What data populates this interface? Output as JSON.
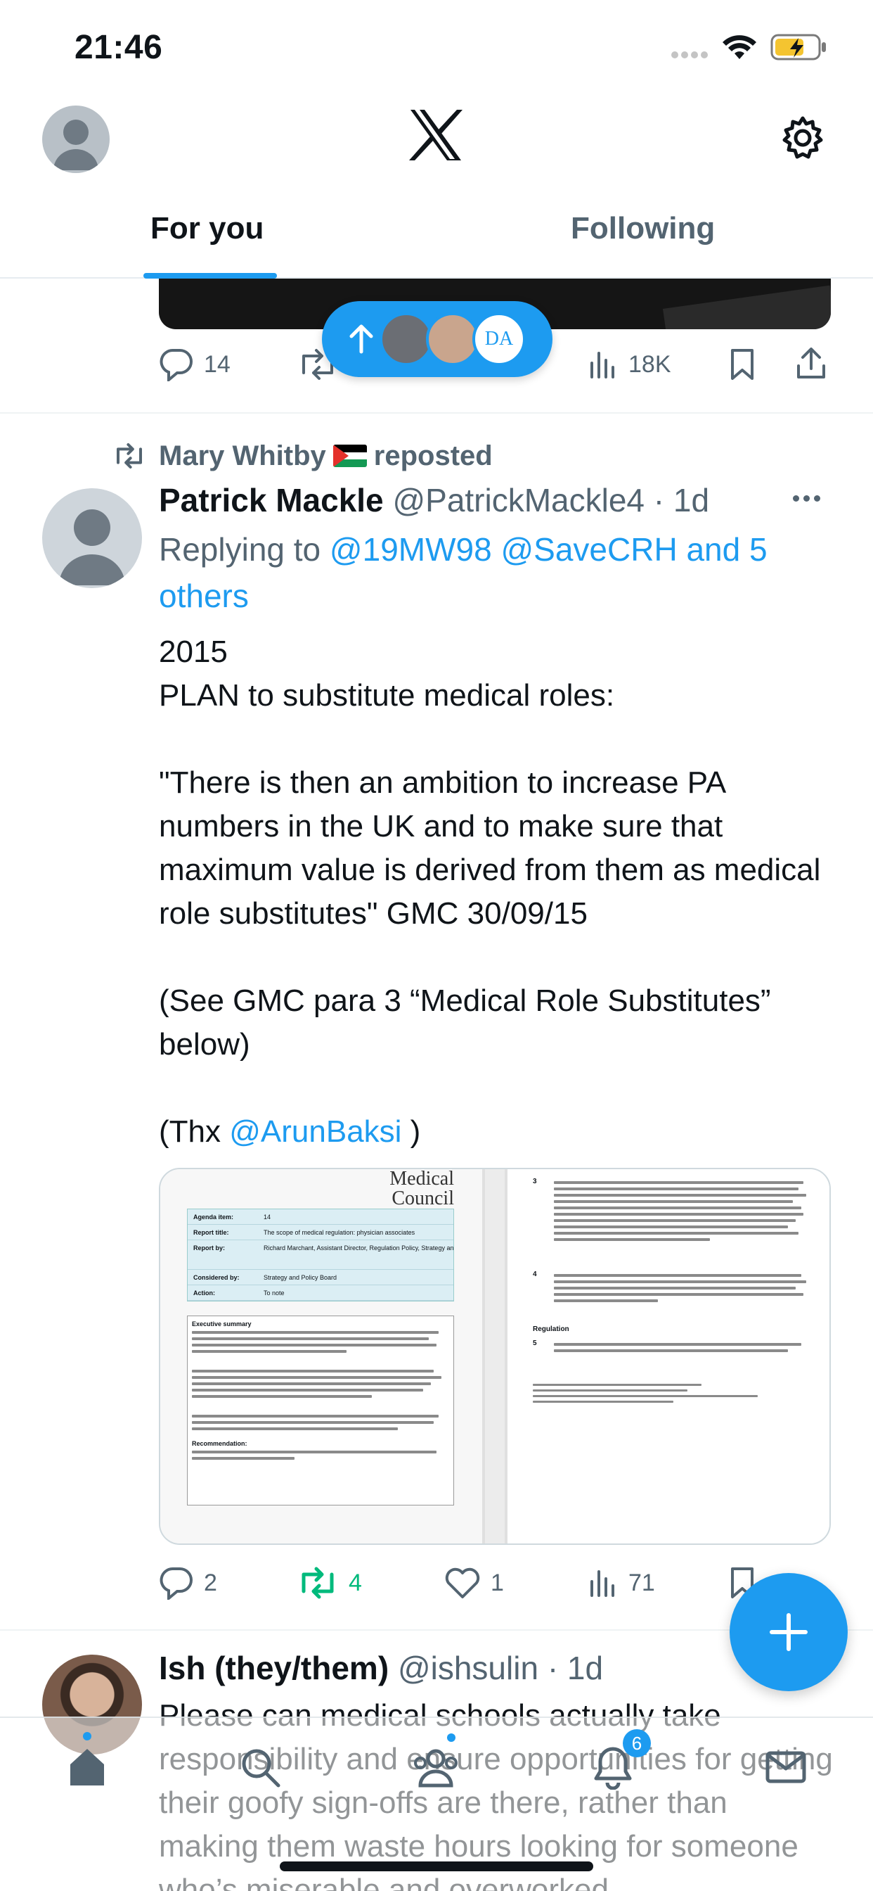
{
  "status_bar": {
    "time": "21:46"
  },
  "header": {
    "tabs": [
      {
        "label": "For you",
        "active": true
      },
      {
        "label": "Following",
        "active": false
      }
    ],
    "icons": {
      "logo": "x-logo-icon",
      "settings": "gear-icon",
      "profile": "avatar"
    }
  },
  "previous_tweet": {
    "replies": "14",
    "views": "18K"
  },
  "tweet": {
    "repost_by": "Mary Whitby",
    "repost_suffix": "reposted",
    "author_name": "Patrick Mackle",
    "author_handle": "@PatrickMackle4",
    "time": "· 1d",
    "replying_prefix": "Replying to",
    "replying_to": "@19MW98 @SaveCRH and 5 others",
    "text_lines": [
      "2015",
      "PLAN to substitute medical roles:",
      "",
      "\"There is then an ambition to increase PA numbers in the UK and to make sure that maximum value is derived from them as medical role substitutes\" GMC 30/09/15",
      "",
      "(See GMC para 3 “Medical Role Substitutes” below)",
      ""
    ],
    "thanks_prefix": "(Thx",
    "thanks_handle": "@ArunBaksi",
    "thanks_suffix": ")",
    "media": {
      "left_header": "Medical\nCouncil",
      "left_rows": [
        {
          "k": "Agenda item:",
          "v": "14"
        },
        {
          "k": "Report title:",
          "v": "The scope of medical regulation: physician associates"
        },
        {
          "k": "Report by:",
          "v": "Richard Marchant, Assistant Director, Regulation Policy, Strategy and Communication;"
        },
        {
          "k": "Considered by:",
          "v": "Strategy and Policy Board"
        },
        {
          "k": "Action:",
          "v": "To note"
        }
      ],
      "left_box_heading": "Executive summary",
      "left_box_footer": "Recommendation:",
      "right_paragraphs": [
        "3",
        "4",
        "5"
      ],
      "right_heading": "Regulation"
    },
    "stats": {
      "replies": "2",
      "reposts": "4",
      "likes": "1",
      "views": "71"
    }
  },
  "next_tweet": {
    "author_name": "Ish (they/them)",
    "author_handle": "@ishsulin",
    "time": "· 1d",
    "text": "Please can medical schools actually take responsibility and ensure opportunities for getting their goofy sign-offs are there, rather than making them waste hours looking for someone who’s miserable and overworked"
  },
  "tabbar": {
    "items": [
      "home-icon",
      "search-icon",
      "communities-icon",
      "notifications-icon",
      "messages-icon"
    ],
    "notification_count": "6"
  },
  "colors": {
    "accent": "#1d9bf0",
    "text": "#0f1419",
    "secondary": "#536471",
    "repost_green": "#00ba7c"
  }
}
